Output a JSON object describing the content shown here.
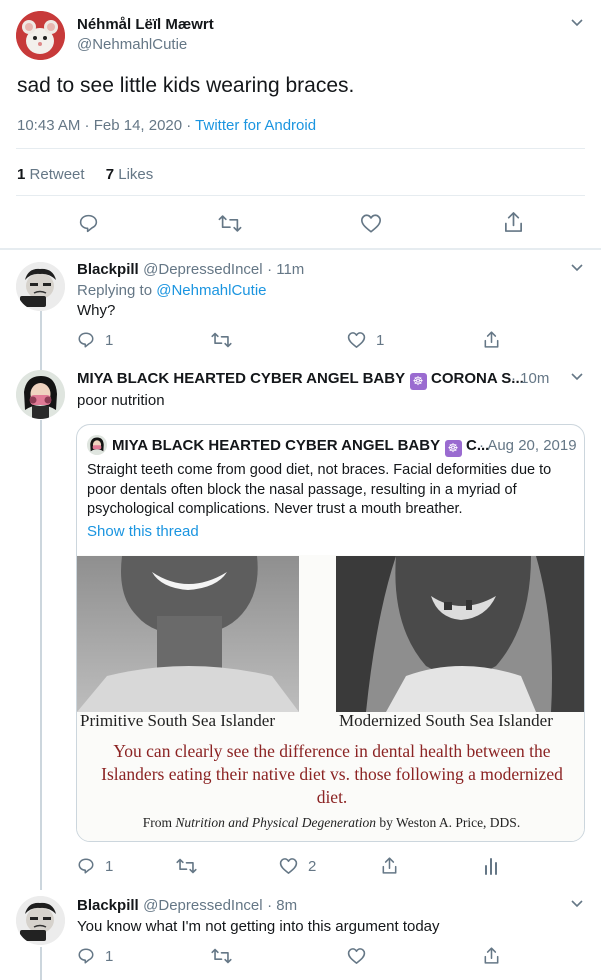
{
  "main_tweet": {
    "name": "Néhmål Lëïl Mæwrt",
    "handle": "@NehmahlCutie",
    "text": "sad to see little kids wearing braces.",
    "timestamp": "10:43 AM · Feb 14, 2020 · ",
    "source": "Twitter for Android",
    "retweet_count": "1",
    "retweet_label": "Retweet",
    "like_count": "7",
    "like_label": "Likes"
  },
  "replies": [
    {
      "name": "Blackpill",
      "handle": "@DepressedIncel",
      "time": "· 11m",
      "replying_prefix": "Replying to ",
      "replying_to": "@NehmahlCutie",
      "text": "Why?",
      "reply_count": "1",
      "like_count": "1"
    },
    {
      "name": "MIYA BLACK HEARTED CYBER ANGEL BABY",
      "name_suffix": "CORONA S...",
      "badge_icon": "dharma-wheel-icon",
      "time": "· 10m",
      "text": "poor nutrition",
      "reply_count": "1",
      "like_count": "2",
      "quote": {
        "name": "MIYA BLACK HEARTED CYBER ANGEL BABY",
        "name_suffix": "C...",
        "time": "· Aug 20, 2019",
        "text": "Straight teeth come from good diet, not braces. Facial deformities due to poor dentals often block the nasal passage, resulting in a myriad of psychological complications. Never trust a mouth breather.",
        "show_thread": "Show this thread",
        "image": {
          "left_caption": "Primitive South Sea Islander",
          "right_caption": "Modernized South Sea Islander",
          "headline": "You can clearly see the difference in dental health between the Islanders eating their native diet vs. those following a modernized diet.",
          "credit_from": "From ",
          "credit_title": "Nutrition and Physical Degeneration",
          "credit_by": " by Weston A. Price, DDS."
        }
      }
    },
    {
      "name": "Blackpill",
      "handle": "@DepressedIncel",
      "time": "· 8m",
      "text": "You know what I'm not getting into this argument today",
      "reply_count": "1"
    }
  ],
  "colors": {
    "link": "#1b95e0",
    "muted": "#657786",
    "divider": "#e6ecf0",
    "badge": "#9a6bd0",
    "caption_red": "#8b2323"
  }
}
